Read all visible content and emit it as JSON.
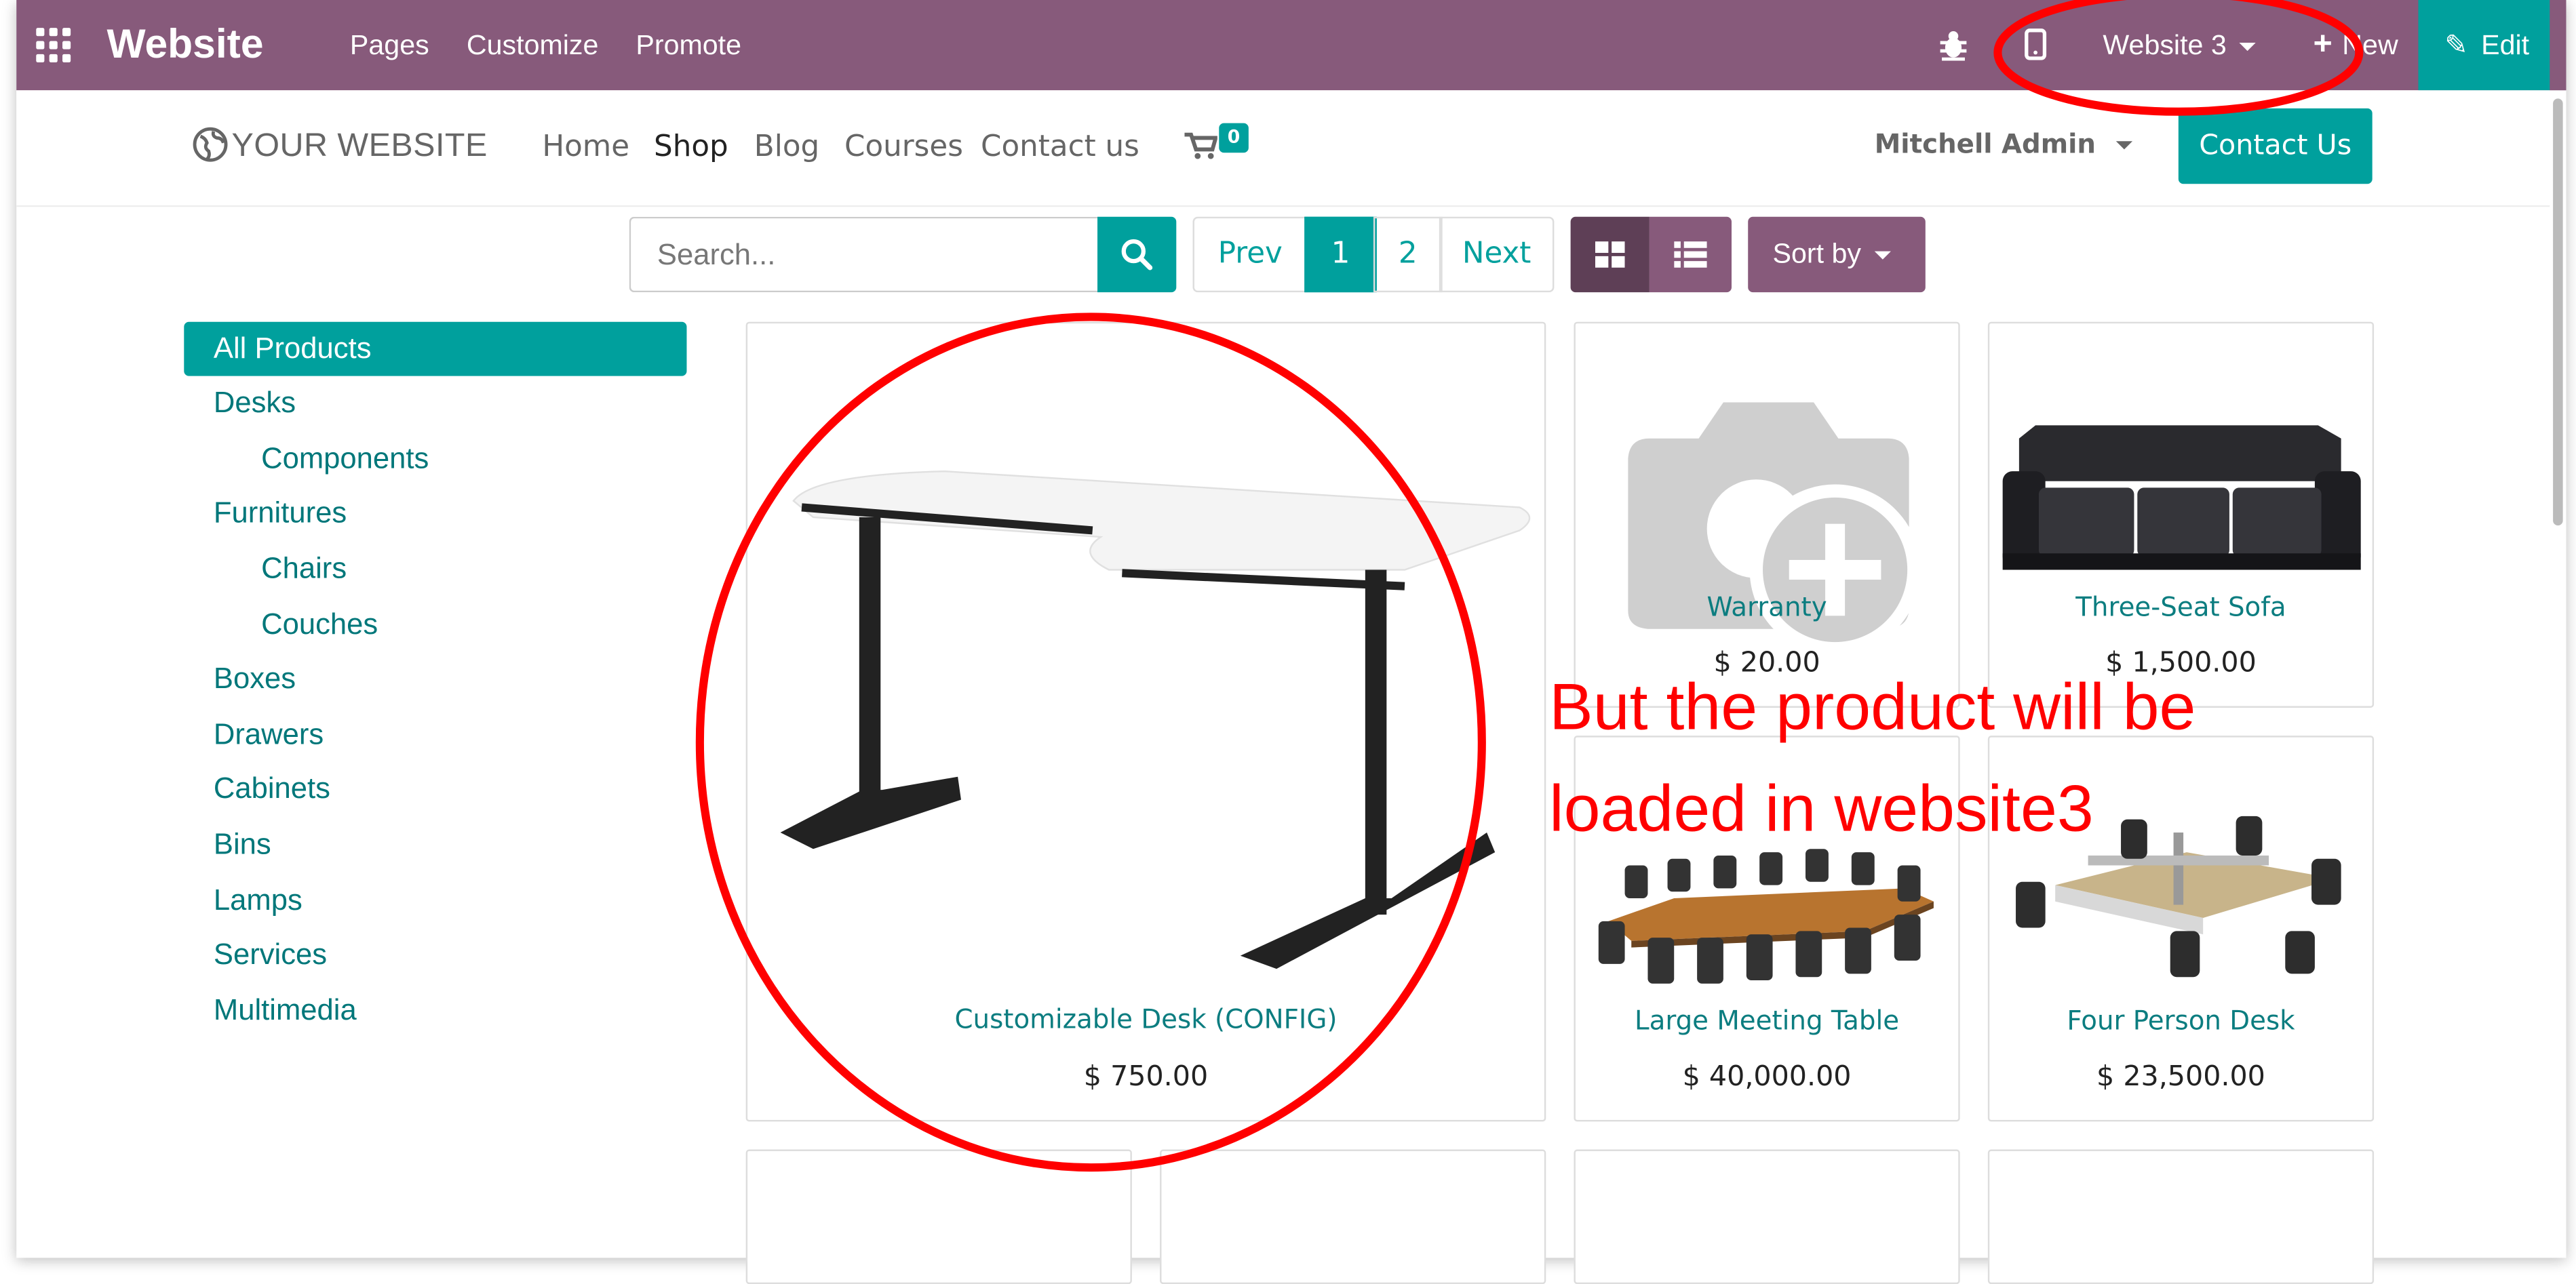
{
  "topbar": {
    "brand": "Website",
    "menu": [
      "Pages",
      "Customize",
      "Promote"
    ],
    "website_selector": "Website 3",
    "new_label": "New",
    "edit_label": "Edit"
  },
  "header": {
    "logo": "YOUR WEBSITE",
    "nav": [
      "Home",
      "Shop",
      "Blog",
      "Courses",
      "Contact us"
    ],
    "cart_count": "0",
    "user": "Mitchell Admin",
    "contact_button": "Contact Us"
  },
  "toolbar": {
    "search_placeholder": "Search...",
    "pager": {
      "prev": "Prev",
      "pages": [
        "1",
        "2"
      ],
      "next": "Next"
    },
    "sort_label": "Sort by"
  },
  "categories": [
    "All Products",
    "Desks",
    "Components",
    "Furnitures",
    "Chairs",
    "Couches",
    "Boxes",
    "Drawers",
    "Cabinets",
    "Bins",
    "Lamps",
    "Services",
    "Multimedia"
  ],
  "products": [
    {
      "name": "Customizable Desk (CONFIG)",
      "price": "$ 750.00"
    },
    {
      "name": "Warranty",
      "price": "$ 20.00"
    },
    {
      "name": "Three-Seat Sofa",
      "price": "$ 1,500.00"
    },
    {
      "name": "Large Meeting Table",
      "price": "$ 40,000.00"
    },
    {
      "name": "Four Person Desk",
      "price": "$ 23,500.00"
    }
  ],
  "annotation": {
    "text_line1": "But the product will be",
    "text_line2": "loaded in website3",
    "color": "#ff0000"
  },
  "colors": {
    "odoo_purple": "#875A7B",
    "teal": "#00A09D"
  }
}
